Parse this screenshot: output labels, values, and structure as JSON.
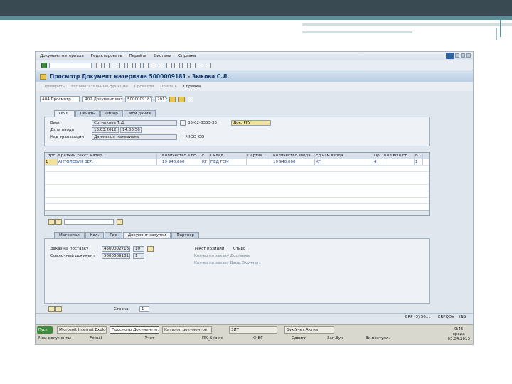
{
  "menu": [
    "Документ материала",
    "Редактировать",
    "Перейти",
    "Система",
    "Справка"
  ],
  "window": {
    "title": "Просмотр Документ материала 5000009181 - Зыкова С.Л."
  },
  "appbar": {
    "items": [
      "Проверить",
      "Вспомогательные функции",
      "Провести",
      "Помощь",
      "Справка"
    ]
  },
  "selection": {
    "action": "A04 Просмотр",
    "ref_doc": "R02 Документ мат.",
    "doc_no": "5000009181",
    "year": "2012"
  },
  "header_tabs": [
    "Общ.",
    "Печать",
    "Обзор",
    "Мой.дания"
  ],
  "header": {
    "user_label": "Ввел",
    "user_value": "Сотникова Т.Д.",
    "phone_value": "35-02-3353-33",
    "call_btn": "Док. РРУ",
    "date_label": "Дата ввода",
    "date_value": "13.03.2012",
    "time_value": "14:06:56",
    "trans_label": "Код транзакции",
    "trans_value": "Движение материала",
    "trans_code": "MIGO_GO"
  },
  "items_table": {
    "columns": [
      "Стро",
      "Краткий текст матер.",
      "",
      "Количество в ЕЕ",
      "Е",
      "Склад",
      "Партия",
      "Количество ввода",
      "Ед.изм.ввода",
      "Пр",
      "Кол.во в ЕЕ",
      "Б"
    ],
    "rows": [
      [
        "1",
        "АНТОЛЕВИН ЗЕЛ.",
        "",
        "19 940,000",
        "КГ",
        "ПЕД ГСМ",
        "",
        "19 940,000",
        "КГ",
        "4",
        "",
        "1"
      ]
    ]
  },
  "detail_tabs": [
    "Материал",
    "Кол.",
    "Где",
    "Документ закупки",
    "Партнер"
  ],
  "detail": {
    "order_label": "Заказ на поставку",
    "order_value": "4500002718",
    "order_pos": "10",
    "ref_label": "Ссылочный документ",
    "ref_value": "5000009181",
    "ref_pos": "1",
    "text_label": "Текст позиции",
    "text_value": "Стиво",
    "chk1": "Кол-во по заказу Доставка",
    "chk2": "Кол-во по заказу Вход.Окончат."
  },
  "footer": {
    "line_label": "Строка",
    "line_value": "1"
  },
  "status": {
    "session": "ERP (3) 50...",
    "server": "ERPQDV",
    "mode": "INS"
  },
  "taskbar": {
    "start": "Пуск",
    "tasks": [
      "Microsoft Internet Explorer",
      "Просмотр Документ м...",
      "Каталог документов",
      "ЗИТ",
      "Бух.Учет.Актив"
    ],
    "quick": [
      "Мои документы",
      "Actual",
      "Учет",
      "ПК_Береж",
      "Ф.ВГ",
      "Сдвиги",
      "Зап.бух",
      "Вх.поступл."
    ],
    "time": "9:45",
    "day": "среда",
    "date": "03.04.2013"
  }
}
